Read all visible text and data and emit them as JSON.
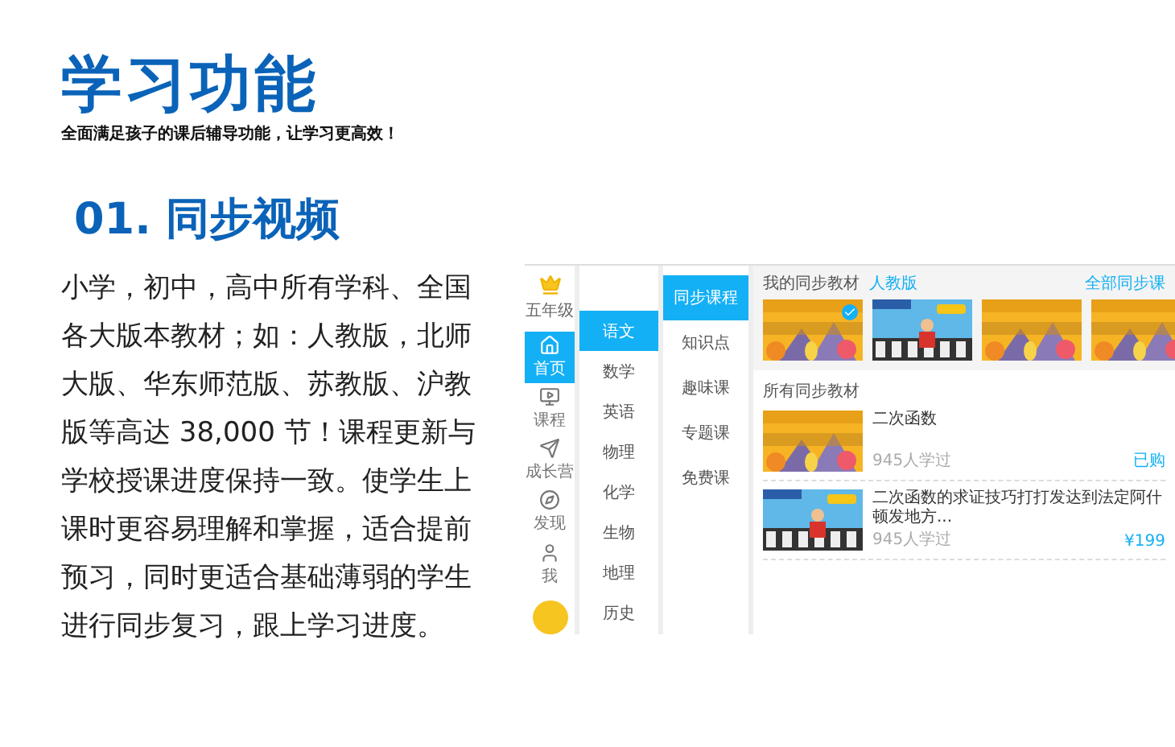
{
  "title": "学习功能",
  "subtitle": "全面满足孩子的课后辅导功能，让学习更高效！",
  "section_title": "01. 同步视频",
  "description": "小学，初中，高中所有学科、全国各大版本教材；如：人教版，北师大版、华东师范版、苏教版、沪教版等高达 38,000 节！课程更新与学校授课进度保持一致。使学生上课时更容易理解和掌握，适合提前预习，同时更适合基础薄弱的学生进行同步复习，跟上学习进度。",
  "app": {
    "grade": "五年级",
    "nav": [
      {
        "label": "首页",
        "selected": true
      },
      {
        "label": "课程",
        "selected": false
      },
      {
        "label": "成长营",
        "selected": false
      },
      {
        "label": "发现",
        "selected": false
      },
      {
        "label": "我",
        "selected": false
      }
    ],
    "subjects": [
      {
        "label": "语文",
        "selected": true
      },
      {
        "label": "数学",
        "selected": false
      },
      {
        "label": "英语",
        "selected": false
      },
      {
        "label": "物理",
        "selected": false
      },
      {
        "label": "化学",
        "selected": false
      },
      {
        "label": "生物",
        "selected": false
      },
      {
        "label": "地理",
        "selected": false
      },
      {
        "label": "历史",
        "selected": false
      }
    ],
    "categories": [
      {
        "label": "同步课程",
        "selected": true
      },
      {
        "label": "知识点",
        "selected": false
      },
      {
        "label": "趣味课",
        "selected": false
      },
      {
        "label": "专题课",
        "selected": false
      },
      {
        "label": "免费课",
        "selected": false
      }
    ],
    "my_books": {
      "heading": "我的同步教材",
      "edition": "人教版",
      "more": "全部同步课",
      "cards": [
        {
          "selected": true
        },
        {
          "selected": false
        },
        {
          "selected": false
        },
        {
          "selected": false
        }
      ]
    },
    "all_books": {
      "heading": "所有同步教材",
      "items": [
        {
          "title": "二次函数",
          "learners": "945人学过",
          "price": "已购"
        },
        {
          "title": "二次函数的求证技巧打打发达到法定阿什顿发地方...",
          "learners": "945人学过",
          "price": "¥199"
        }
      ]
    }
  }
}
